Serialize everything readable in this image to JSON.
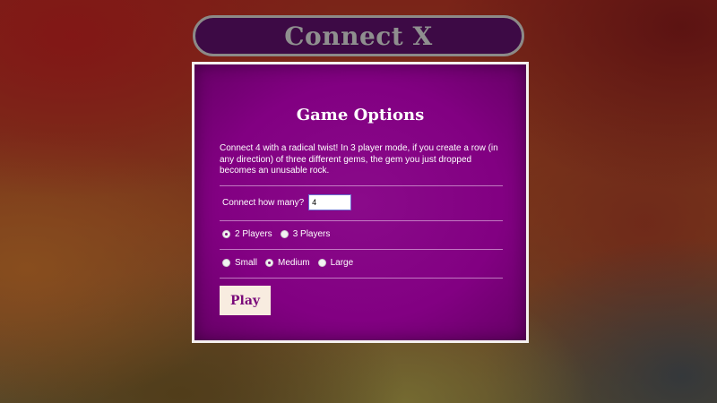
{
  "header": {
    "title": "Connect X"
  },
  "options": {
    "heading": "Game Options",
    "description": "Connect 4 with a radical twist! In 3 player mode, if you create a row (in any direction) of three different gems, the gem you just dropped becomes an unusable rock.",
    "connect_label": "Connect how many?",
    "connect_value": "4",
    "players": [
      {
        "label": "2 Players",
        "selected": true
      },
      {
        "label": "3 Players",
        "selected": false
      }
    ],
    "sizes": [
      {
        "label": "Small",
        "selected": false
      },
      {
        "label": "Medium",
        "selected": true
      },
      {
        "label": "Large",
        "selected": false
      }
    ],
    "play_label": "Play"
  },
  "colors": {
    "panel_purple": "#820082",
    "title_bar": "#3d0a45",
    "play_button_bg": "#f8ece0",
    "play_button_text": "#7a0a7a"
  }
}
